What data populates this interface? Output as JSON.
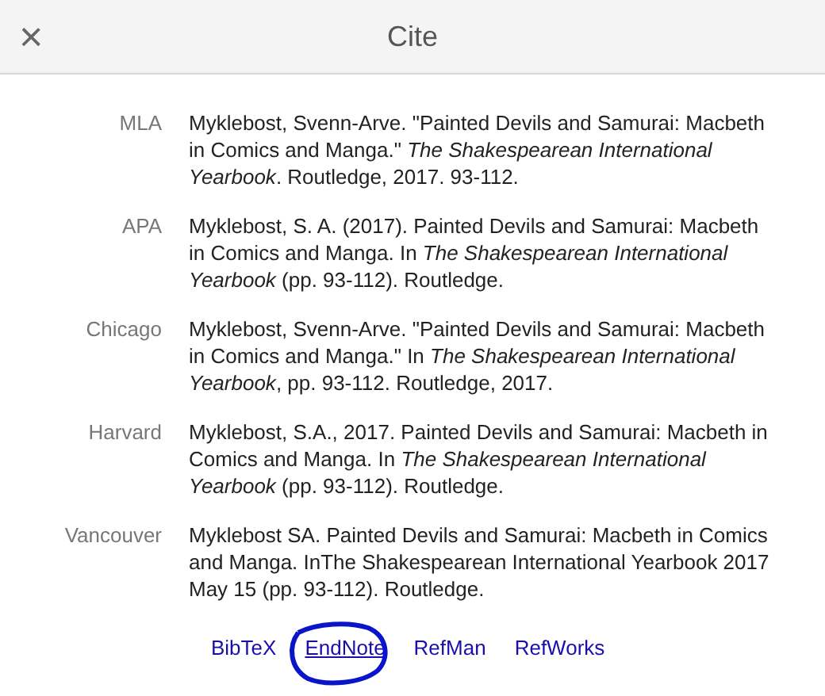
{
  "dialog": {
    "title": "Cite",
    "close": "×"
  },
  "citations": [
    {
      "style": "MLA",
      "text": "Myklebost, Svenn-Arve. \"Painted Devils and Samurai: Macbeth in Comics and Manga.\" *The Shakespearean International Yearbook*. Routledge, 2017. 93-112."
    },
    {
      "style": "APA",
      "text": "Myklebost, S. A. (2017). Painted Devils and Samurai: Macbeth in Comics and Manga. In *The Shakespearean International Yearbook* (pp. 93-112). Routledge."
    },
    {
      "style": "Chicago",
      "text": "Myklebost, Svenn-Arve. \"Painted Devils and Samurai: Macbeth in Comics and Manga.\" In *The Shakespearean International Yearbook*, pp. 93-112. Routledge, 2017."
    },
    {
      "style": "Harvard",
      "text": "Myklebost, S.A., 2017. Painted Devils and Samurai: Macbeth in Comics and Manga. In *The Shakespearean International Yearbook* (pp. 93-112). Routledge."
    },
    {
      "style": "Vancouver",
      "text": "Myklebost SA. Painted Devils and Samurai: Macbeth in Comics and Manga. InThe Shakespearean International Yearbook 2017 May 15 (pp. 93-112). Routledge."
    }
  ],
  "export_links": [
    {
      "label": "BibTeX",
      "underlined": false,
      "circled": false
    },
    {
      "label": "EndNote",
      "underlined": true,
      "circled": true
    },
    {
      "label": "RefMan",
      "underlined": false,
      "circled": false
    },
    {
      "label": "RefWorks",
      "underlined": false,
      "circled": false
    }
  ]
}
